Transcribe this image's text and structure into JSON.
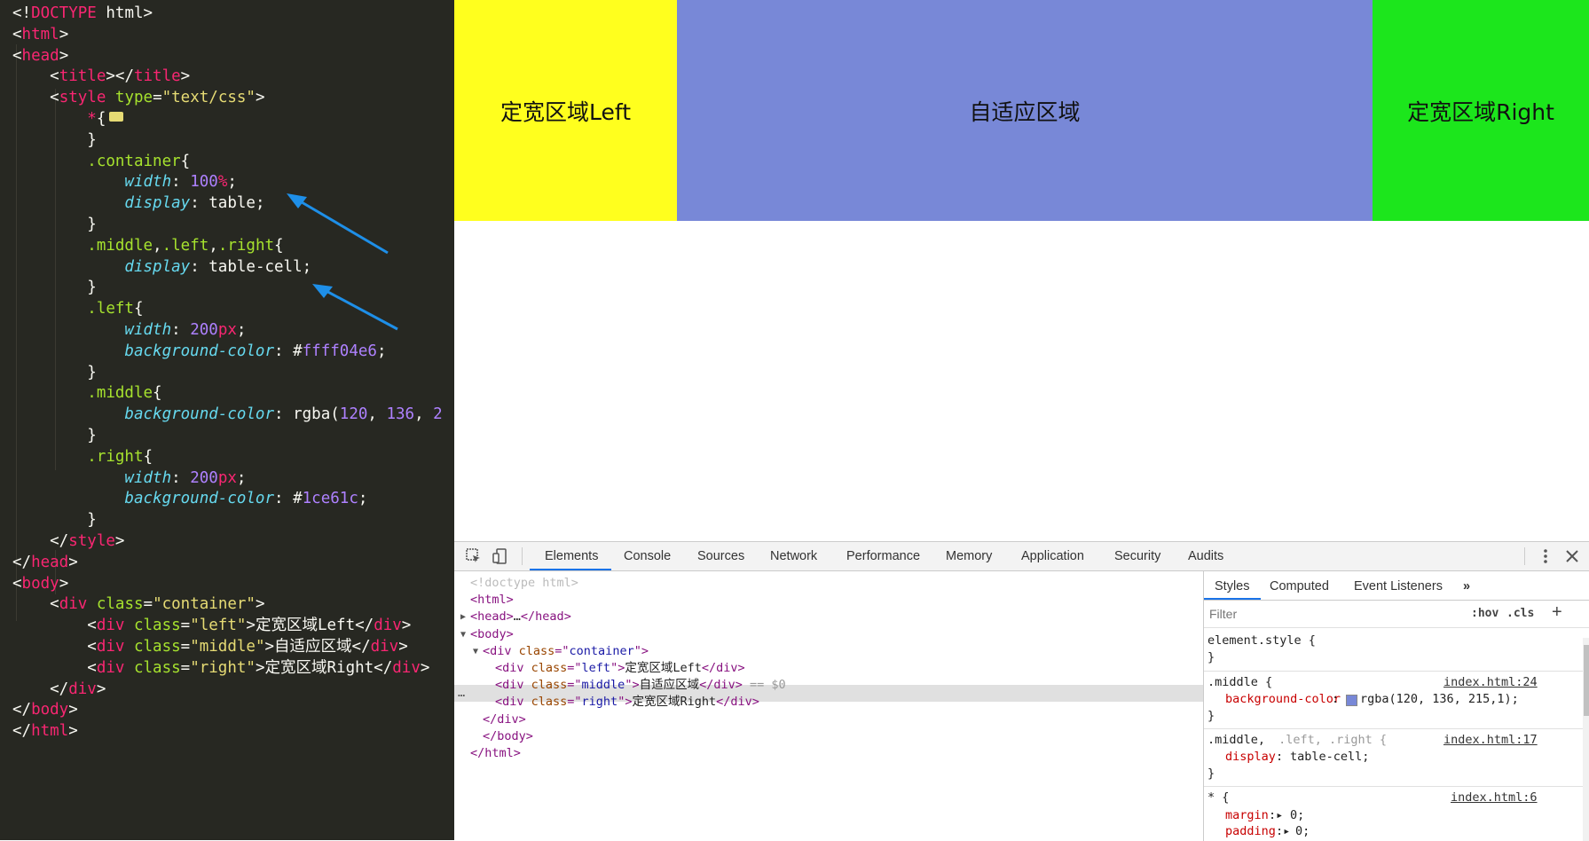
{
  "editor": {
    "lines": [
      {
        "parts": [
          [
            "p",
            "<!"
          ],
          [
            "t",
            "DOCTYPE"
          ],
          [
            "p",
            " html>"
          ]
        ]
      },
      {
        "parts": [
          [
            "p",
            "<"
          ],
          [
            "t",
            "html"
          ],
          [
            "p",
            ">"
          ]
        ]
      },
      {
        "parts": [
          [
            "p",
            "<"
          ],
          [
            "t",
            "head"
          ],
          [
            "p",
            ">"
          ]
        ]
      },
      {
        "parts": [
          [
            "p",
            "    <"
          ],
          [
            "t",
            "title"
          ],
          [
            "p",
            "></"
          ],
          [
            "t",
            "title"
          ],
          [
            "p",
            ">"
          ]
        ]
      },
      {
        "parts": [
          [
            "p",
            "    <"
          ],
          [
            "t",
            "style"
          ],
          [
            "a",
            " type"
          ],
          [
            "p",
            "="
          ],
          [
            "s",
            "\"text/css\""
          ],
          [
            "p",
            ">"
          ]
        ]
      },
      {
        "parts": [
          [
            "t",
            "        *"
          ],
          [
            "p",
            "{"
          ]
        ],
        "fold": true
      },
      {
        "parts": [
          [
            "p",
            "        }"
          ]
        ]
      },
      {
        "parts": [
          [
            "sel",
            "        .container"
          ],
          [
            "p",
            "{"
          ]
        ]
      },
      {
        "parts": [
          [
            "pr",
            "            width"
          ],
          [
            "p",
            ": "
          ],
          [
            "n",
            "100"
          ],
          [
            "t",
            "%"
          ],
          [
            "p",
            ";"
          ]
        ]
      },
      {
        "parts": [
          [
            "pr",
            "            display"
          ],
          [
            "p",
            ": "
          ],
          [
            "c",
            "table"
          ],
          [
            "p",
            ";"
          ]
        ]
      },
      {
        "parts": [
          [
            "p",
            "        }"
          ]
        ]
      },
      {
        "parts": [
          [
            "sel",
            "        .middle"
          ],
          [
            "p",
            ","
          ],
          [
            "sel",
            ".left"
          ],
          [
            "p",
            ","
          ],
          [
            "sel",
            ".right"
          ],
          [
            "p",
            "{"
          ]
        ]
      },
      {
        "parts": [
          [
            "pr",
            "            display"
          ],
          [
            "p",
            ": "
          ],
          [
            "c",
            "table-cell"
          ],
          [
            "p",
            ";"
          ]
        ]
      },
      {
        "parts": [
          [
            "p",
            "        }"
          ]
        ]
      },
      {
        "parts": [
          [
            "sel",
            "        .left"
          ],
          [
            "p",
            "{"
          ]
        ]
      },
      {
        "parts": [
          [
            "pr",
            "            width"
          ],
          [
            "p",
            ": "
          ],
          [
            "n",
            "200"
          ],
          [
            "t",
            "px"
          ],
          [
            "p",
            ";"
          ]
        ]
      },
      {
        "parts": [
          [
            "pr",
            "            background-color"
          ],
          [
            "p",
            ": "
          ],
          [
            "v",
            "#"
          ],
          [
            "n",
            "ffff04e6"
          ],
          [
            "p",
            ";"
          ]
        ]
      },
      {
        "parts": [
          [
            "p",
            "        }"
          ]
        ]
      },
      {
        "parts": [
          [
            "sel",
            "        .middle"
          ],
          [
            "p",
            "{"
          ]
        ]
      },
      {
        "parts": [
          [
            "pr",
            "            background-color"
          ],
          [
            "p",
            ": "
          ],
          [
            "c",
            "rgba"
          ],
          [
            "p",
            "("
          ],
          [
            "n",
            "120"
          ],
          [
            "p",
            ", "
          ],
          [
            "n",
            "136"
          ],
          [
            "p",
            ", "
          ],
          [
            "n",
            "2"
          ]
        ]
      },
      {
        "parts": [
          [
            "p",
            "        }"
          ]
        ]
      },
      {
        "parts": [
          [
            "sel",
            "        .right"
          ],
          [
            "p",
            "{"
          ]
        ]
      },
      {
        "parts": [
          [
            "pr",
            "            width"
          ],
          [
            "p",
            ": "
          ],
          [
            "n",
            "200"
          ],
          [
            "t",
            "px"
          ],
          [
            "p",
            ";"
          ]
        ]
      },
      {
        "parts": [
          [
            "pr",
            "            background-color"
          ],
          [
            "p",
            ": "
          ],
          [
            "v",
            "#"
          ],
          [
            "n",
            "1ce61c"
          ],
          [
            "p",
            ";"
          ]
        ]
      },
      {
        "parts": [
          [
            "p",
            "        }"
          ]
        ]
      },
      {
        "parts": [
          [
            "p",
            "    </"
          ],
          [
            "t",
            "style"
          ],
          [
            "p",
            ">"
          ]
        ]
      },
      {
        "parts": [
          [
            "p",
            "</"
          ],
          [
            "t",
            "head"
          ],
          [
            "p",
            ">"
          ]
        ]
      },
      {
        "parts": [
          [
            "p",
            "<"
          ],
          [
            "t",
            "body"
          ],
          [
            "p",
            ">"
          ]
        ]
      },
      {
        "parts": [
          [
            "p",
            "    <"
          ],
          [
            "t",
            "div"
          ],
          [
            "a",
            " class"
          ],
          [
            "p",
            "="
          ],
          [
            "s",
            "\"container\""
          ],
          [
            "p",
            ">"
          ]
        ]
      },
      {
        "parts": [
          [
            "p",
            "        <"
          ],
          [
            "t",
            "div"
          ],
          [
            "a",
            " class"
          ],
          [
            "p",
            "="
          ],
          [
            "s",
            "\"left\""
          ],
          [
            "p",
            ">定宽区域Left</"
          ],
          [
            "t",
            "div"
          ],
          [
            "p",
            ">"
          ]
        ]
      },
      {
        "parts": [
          [
            "p",
            "        <"
          ],
          [
            "t",
            "div"
          ],
          [
            "a",
            " class"
          ],
          [
            "p",
            "="
          ],
          [
            "s",
            "\"middle\""
          ],
          [
            "p",
            ">自适应区域</"
          ],
          [
            "t",
            "div"
          ],
          [
            "p",
            ">"
          ]
        ]
      },
      {
        "parts": [
          [
            "p",
            "        <"
          ],
          [
            "t",
            "div"
          ],
          [
            "a",
            " class"
          ],
          [
            "p",
            "="
          ],
          [
            "s",
            "\"right\""
          ],
          [
            "p",
            ">定宽区域Right</"
          ],
          [
            "t",
            "div"
          ],
          [
            "p",
            ">"
          ]
        ]
      },
      {
        "parts": [
          [
            "p",
            "    </"
          ],
          [
            "t",
            "div"
          ],
          [
            "p",
            ">"
          ]
        ]
      },
      {
        "parts": [
          [
            "p",
            "</"
          ],
          [
            "t",
            "body"
          ],
          [
            "p",
            ">"
          ]
        ]
      },
      {
        "parts": [
          [
            "p",
            "</"
          ],
          [
            "t",
            "html"
          ],
          [
            "p",
            ">"
          ]
        ]
      }
    ]
  },
  "page": {
    "left_text": "定宽区域Left",
    "middle_text": "自适应区域",
    "right_text": "定宽区域Right",
    "left_color": "#ffff1e",
    "middle_color": "#7888d7",
    "right_color": "#1ce61c"
  },
  "devtools": {
    "tabs": [
      "Elements",
      "Console",
      "Sources",
      "Network",
      "Performance",
      "Memory",
      "Application",
      "Security",
      "Audits"
    ],
    "active_tab": "Elements",
    "dom": [
      {
        "indent": 0,
        "parts": [
          [
            "ed",
            "<!doctype html>"
          ]
        ]
      },
      {
        "indent": 0,
        "parts": [
          [
            "et",
            "<html>"
          ]
        ]
      },
      {
        "indent": 0,
        "tri": "▶",
        "parts": [
          [
            "et",
            "<head>"
          ],
          [
            "etx",
            "…"
          ],
          [
            "et",
            "</head>"
          ]
        ]
      },
      {
        "indent": 0,
        "tri": "▼",
        "parts": [
          [
            "et",
            "<body>"
          ]
        ]
      },
      {
        "indent": 1,
        "tri": "▼",
        "parts": [
          [
            "et",
            "<div "
          ],
          [
            "ea",
            "class"
          ],
          [
            "et",
            "=\""
          ],
          [
            "ev",
            "container"
          ],
          [
            "et",
            "\">"
          ]
        ]
      },
      {
        "indent": 2,
        "parts": [
          [
            "et",
            "<div "
          ],
          [
            "ea",
            "class"
          ],
          [
            "et",
            "=\""
          ],
          [
            "ev",
            "left"
          ],
          [
            "et",
            "\">"
          ],
          [
            "etx",
            "定宽区域Left"
          ],
          [
            "et",
            "</div>"
          ]
        ]
      },
      {
        "indent": 2,
        "parts": [
          [
            "et",
            "<div "
          ],
          [
            "ea",
            "class"
          ],
          [
            "et",
            "=\""
          ],
          [
            "ev",
            "middle"
          ],
          [
            "et",
            "\">"
          ],
          [
            "etx",
            "自适应区域"
          ],
          [
            "et",
            "</div>"
          ],
          [
            "eg",
            " == $0"
          ]
        ]
      },
      {
        "indent": 2,
        "parts": [
          [
            "et",
            "<div "
          ],
          [
            "ea",
            "class"
          ],
          [
            "et",
            "=\""
          ],
          [
            "ev",
            "right"
          ],
          [
            "et",
            "\">"
          ],
          [
            "etx",
            "定宽区域Right"
          ],
          [
            "et",
            "</div>"
          ]
        ]
      },
      {
        "indent": 1,
        "parts": [
          [
            "et",
            "</div>"
          ]
        ]
      },
      {
        "indent": 1,
        "parts": [
          [
            "et",
            "</body>"
          ]
        ]
      },
      {
        "indent": 0,
        "parts": [
          [
            "et",
            "</html>"
          ]
        ]
      }
    ],
    "styles": {
      "tabs": [
        "Styles",
        "Computed",
        "Event Listeners"
      ],
      "more": "»",
      "filter_placeholder": "Filter",
      "hov": ":hov",
      "cls": ".cls",
      "plus": "+",
      "element_style": "element.style {",
      "close_brace": "}",
      "rule1_selector": ".middle {",
      "rule1_source": "index.html:24",
      "rule1_prop": "background-color",
      "rule1_value": "rgba(120, 136, 215,1);",
      "rule2_selector_main": ".middle,",
      "rule2_selector_rest": " .left, .right {",
      "rule2_source": "index.html:17",
      "rule2_prop": "display",
      "rule2_value": "table-cell;",
      "rule3_selector": "* {",
      "rule3_source": "index.html:6",
      "rule3_prop1": "margin",
      "rule3_value1": "0;",
      "rule3_prop2": "padding",
      "rule3_value2": "0;"
    }
  }
}
